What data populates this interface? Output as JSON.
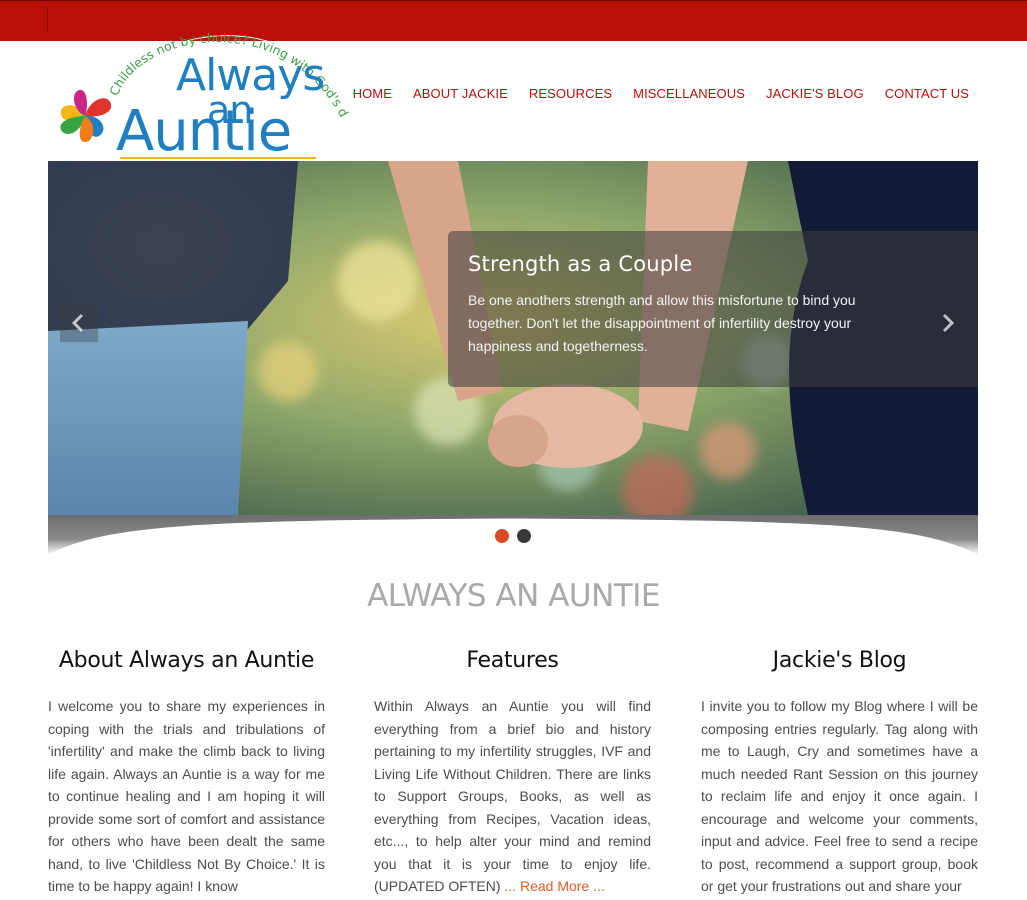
{
  "brand": {
    "logo_top": "Always",
    "logo_mid": "an",
    "logo_bottom": "Auntie",
    "tagline": "Childless not by choice? Living with God's decision..."
  },
  "nav": {
    "items": [
      "HOME",
      "ABOUT JACKIE",
      "RESOURCES",
      "MISCELLANEOUS",
      "JACKIE'S BLOG",
      "CONTACT US"
    ]
  },
  "slider": {
    "title": "Strength as a Couple",
    "text": "Be one anothers strength and allow this misfortune to bind you together. Don't let the disappointment of infertility destroy your happiness and togetherness.",
    "prev_icon": "chevron-left-icon",
    "next_icon": "chevron-right-icon",
    "active_slide": 1,
    "slide_count": 2
  },
  "section_title": "ALWAYS AN AUNTIE",
  "columns": [
    {
      "heading": "About Always an Auntie",
      "text": "I welcome you to share my experiences in coping with the trials and tribulations of 'infertility' and make the climb back to living life again. Always an Auntie is a way for me to continue healing and I am hoping it will provide some sort of comfort and assistance for others who have been dealt the same hand, to live 'Childless Not By Choice.' It is time to be happy again! I know"
    },
    {
      "heading": "Features",
      "text": "Within Always an Auntie you will find everything from a brief bio and history pertaining to my infertility struggles, IVF and Living Life Without Children. There are links to Support Groups, Books, as well as everything from Recipes, Vacation ideas, etc..., to help alter your mind and remind you that it is your time to enjoy life. (UPDATED OFTEN)",
      "link": "... Read More ..."
    },
    {
      "heading": "Jackie's Blog",
      "text": "I invite you to follow my Blog where I will be composing entries regularly. Tag along with me to Laugh, Cry and sometimes have a much needed Rant Session on this journey to reclaim life and enjoy it once again. I encourage and welcome your comments, input and advice. Feel free to send a recipe to post, recommend a support group, book or get your frustrations out and share your"
    }
  ],
  "colors": {
    "topbar": "#ba1009",
    "nav_text": "#b3120c",
    "logo_blue": "#1f7fc1",
    "logo_green": "#3aa343",
    "dot_active": "#d94a25",
    "dot_inactive": "#3a3a3a",
    "link": "#e05d25"
  }
}
